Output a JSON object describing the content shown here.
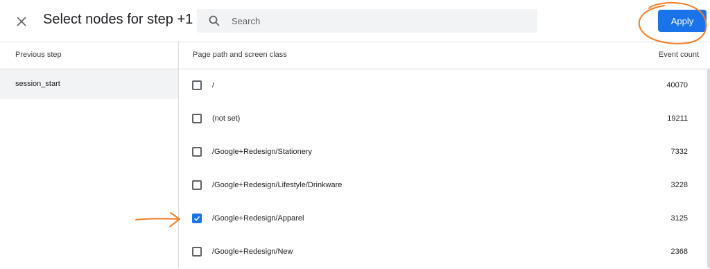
{
  "dialog": {
    "title": "Select nodes for step +1",
    "close_icon": "close-icon"
  },
  "search": {
    "placeholder": "Search",
    "value": "",
    "icon": "search-icon"
  },
  "apply_label": "Apply",
  "sidebar": {
    "header": "Previous step",
    "items": [
      {
        "label": "session_start",
        "selected": true
      }
    ]
  },
  "table": {
    "col_path": "Page path and screen class",
    "col_count": "Event count",
    "rows": [
      {
        "path": "/",
        "count": "40070",
        "checked": false
      },
      {
        "path": "(not set)",
        "count": "19211",
        "checked": false
      },
      {
        "path": "/Google+Redesign/Stationery",
        "count": "7332",
        "checked": false
      },
      {
        "path": "/Google+Redesign/Lifestyle/Drinkware",
        "count": "3228",
        "checked": false
      },
      {
        "path": "/Google+Redesign/Apparel",
        "count": "3125",
        "checked": true
      },
      {
        "path": "/Google+Redesign/New",
        "count": "2368",
        "checked": false
      }
    ]
  },
  "colors": {
    "accent": "#1a73e8",
    "annotation": "#f57c22",
    "selected_bg": "#f1f3f4"
  }
}
